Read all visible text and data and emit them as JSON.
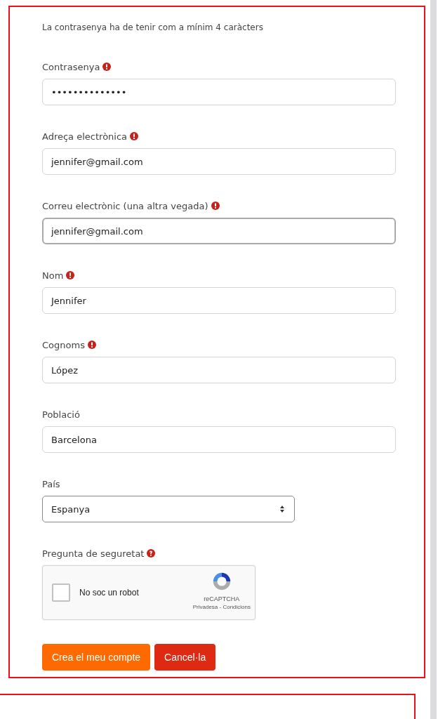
{
  "hint": "La contrasenya ha de tenir com a mínim 4 caràcters",
  "fields": [
    {
      "label": "Contrasenya",
      "required": true,
      "kind": "text",
      "value": "••••••••••••••",
      "focused": false
    },
    {
      "label": "Adreça electrònica",
      "required": true,
      "kind": "text",
      "value": "jennifer@gmail.com",
      "focused": false
    },
    {
      "label": "Correu electrònic (una altra vegada)",
      "required": true,
      "kind": "text",
      "value": "jennifer@gmail.com",
      "focused": true
    },
    {
      "label": "Nom",
      "required": true,
      "kind": "text",
      "value": "Jennifer",
      "focused": false
    },
    {
      "label": "Cognoms",
      "required": true,
      "kind": "text",
      "value": "López",
      "focused": false
    },
    {
      "label": "Població",
      "required": false,
      "kind": "text",
      "value": "Barcelona",
      "focused": false
    },
    {
      "label": "País",
      "required": false,
      "kind": "select",
      "value": "Espanya",
      "focused": false
    }
  ],
  "security": {
    "label": "Pregunta de seguretat",
    "help": true,
    "captcha": {
      "label": "No soc un robot",
      "checked": false,
      "brand": "reCAPTCHA",
      "links": "Privadesa - Condicions"
    }
  },
  "buttons": [
    {
      "label": "Crea el meu compte",
      "kind": "primary"
    },
    {
      "label": "Cancel·la",
      "kind": "danger"
    }
  ]
}
